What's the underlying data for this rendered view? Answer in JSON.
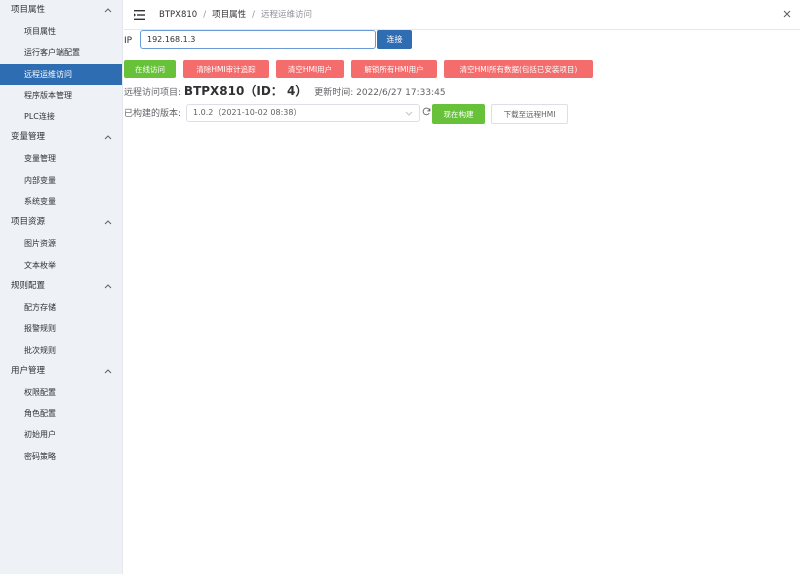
{
  "sidebar": {
    "groups": [
      {
        "title": "项目属性",
        "items": [
          "项目属性",
          "运行客户端配置",
          "远程运维访问",
          "程序版本管理",
          "PLC连接"
        ]
      },
      {
        "title": "变量管理",
        "items": [
          "变量管理",
          "内部变量",
          "系统变量"
        ]
      },
      {
        "title": "项目资源",
        "items": [
          "图片资源",
          "文本枚举"
        ]
      },
      {
        "title": "规则配置",
        "items": [
          "配方存储",
          "报警规则",
          "批次规则"
        ]
      },
      {
        "title": "用户管理",
        "items": [
          "权限配置",
          "角色配置",
          "初始用户",
          "密码策略"
        ]
      }
    ]
  },
  "breadcrumb": {
    "root": "BTPX810",
    "sep": "/",
    "parent": "项目属性",
    "current": "远程运维访问"
  },
  "ip": {
    "label": "IP",
    "value": "192.168.1.3",
    "connect_label": "连接"
  },
  "actions": {
    "online_access": "在线访问",
    "clear_audit": "清除HMI审计追踪",
    "clear_users": "清空HMI用户",
    "unlock_users": "解锁所有HMI用户",
    "clear_all": "清空HMI所有数据(包括已安装项目)"
  },
  "project": {
    "label": "远程访问项目:",
    "name": "BTPX810",
    "id_text": "（ID： 4）",
    "updated_label": "更新时间:",
    "updated_value": "2022/6/27 17:33:45"
  },
  "version": {
    "label": "已构建的版本:",
    "selected": "1.0.2（2021-10-02 08:38）",
    "build_label": "现在构建",
    "download_label": "下载至远程HMI"
  },
  "colors": {
    "accent": "#2f6db3",
    "success": "#67c23a",
    "danger": "#f56c6c",
    "sidebar_bg": "#eef1f6"
  }
}
